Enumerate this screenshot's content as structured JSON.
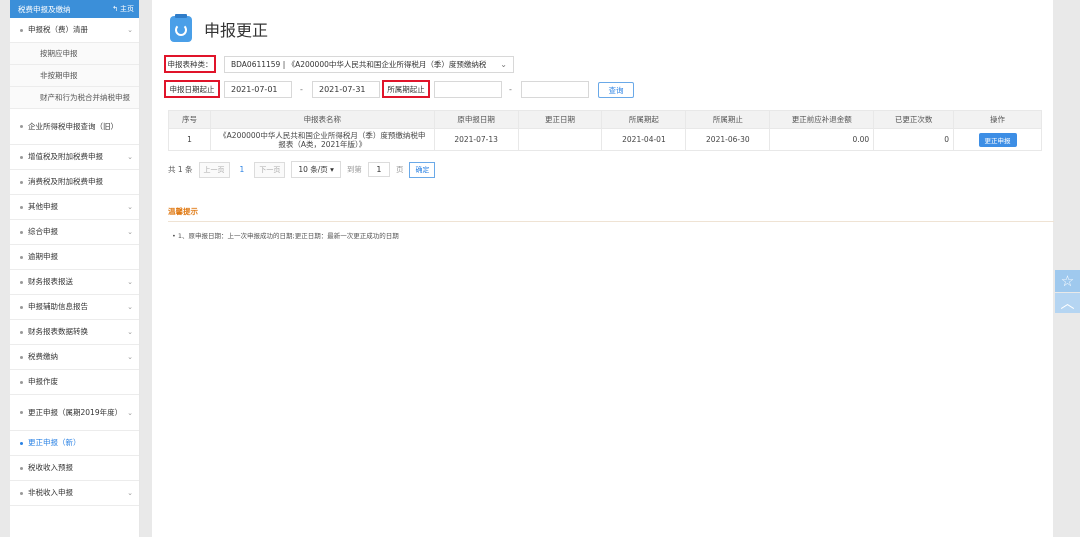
{
  "sidebar": {
    "header_title": "税费申报及缴纳",
    "home_label": "主页",
    "items": [
      {
        "label": "申报税（费）清册",
        "chevron": "⌄"
      },
      {
        "label": "按期应申报"
      },
      {
        "label": "非按期申报"
      },
      {
        "label": "财产和行为税合并纳税申报"
      },
      {
        "label": "企业所得税申报查询（旧）"
      },
      {
        "label": "增值税及附加税费申报",
        "chevron": "⌄"
      },
      {
        "label": "消费税及附加税费申报"
      },
      {
        "label": "其他申报",
        "chevron": "⌄"
      },
      {
        "label": "综合申报",
        "chevron": "⌄"
      },
      {
        "label": "逾期申报"
      },
      {
        "label": "财务报表报送",
        "chevron": "⌄"
      },
      {
        "label": "申报辅助信息报告",
        "chevron": "⌄"
      },
      {
        "label": "财务报表数据转换",
        "chevron": "⌄"
      },
      {
        "label": "税费缴纳",
        "chevron": "⌄"
      },
      {
        "label": "申报作废"
      },
      {
        "label": "更正申报（属期2019年度）",
        "chevron": "⌄"
      },
      {
        "label": "更正申报（新）"
      },
      {
        "label": "税收收入预报"
      },
      {
        "label": "非税收入申报",
        "chevron": "⌄"
      }
    ]
  },
  "main": {
    "page_title": "申报更正",
    "form": {
      "report_type_label": "申报表种类：",
      "report_type_value": "BDA0611159 | 《A200000中华人民共和国企业所得税月（季）度预缴纳税",
      "report_type_chevron": "⌄",
      "date_range_label": "申报日期起止",
      "date_start": "2021-07-01",
      "date_end": "2021-07-31",
      "period_label": "所属期起止",
      "period_start": "",
      "period_end": "",
      "dash": "-",
      "query_label": "查询"
    },
    "table": {
      "headers": [
        "序号",
        "申报表名称",
        "原申报日期",
        "更正日期",
        "所属期起",
        "所属期止",
        "更正前应补退金额",
        "已更正次数",
        "操作"
      ],
      "rows": [
        {
          "index": "1",
          "name": "《A200000中华人民共和国企业所得税月（季）度预缴纳税申报表（A类，2021年版）》",
          "orig_date": "2021-07-13",
          "fix_date": "",
          "period_start": "2021-04-01",
          "period_end": "2021-06-30",
          "amount": "0.00",
          "count": "0",
          "action": "更正申报"
        }
      ]
    },
    "pager": {
      "total": "共 1 条",
      "prev": "上一页",
      "current": "1",
      "next": "下一页",
      "page_size": "10 条/页 ▾",
      "goto": "到第",
      "goto_value": "1",
      "page_unit": "页",
      "confirm": "确定"
    },
    "tips": {
      "title": "温馨提示",
      "item": "• 1、原申报日期：上一次申报成功的日期;更正日期：最新一次更正成功的日期"
    }
  },
  "float": {
    "star_icon": "☆",
    "top_icon": "︿"
  }
}
